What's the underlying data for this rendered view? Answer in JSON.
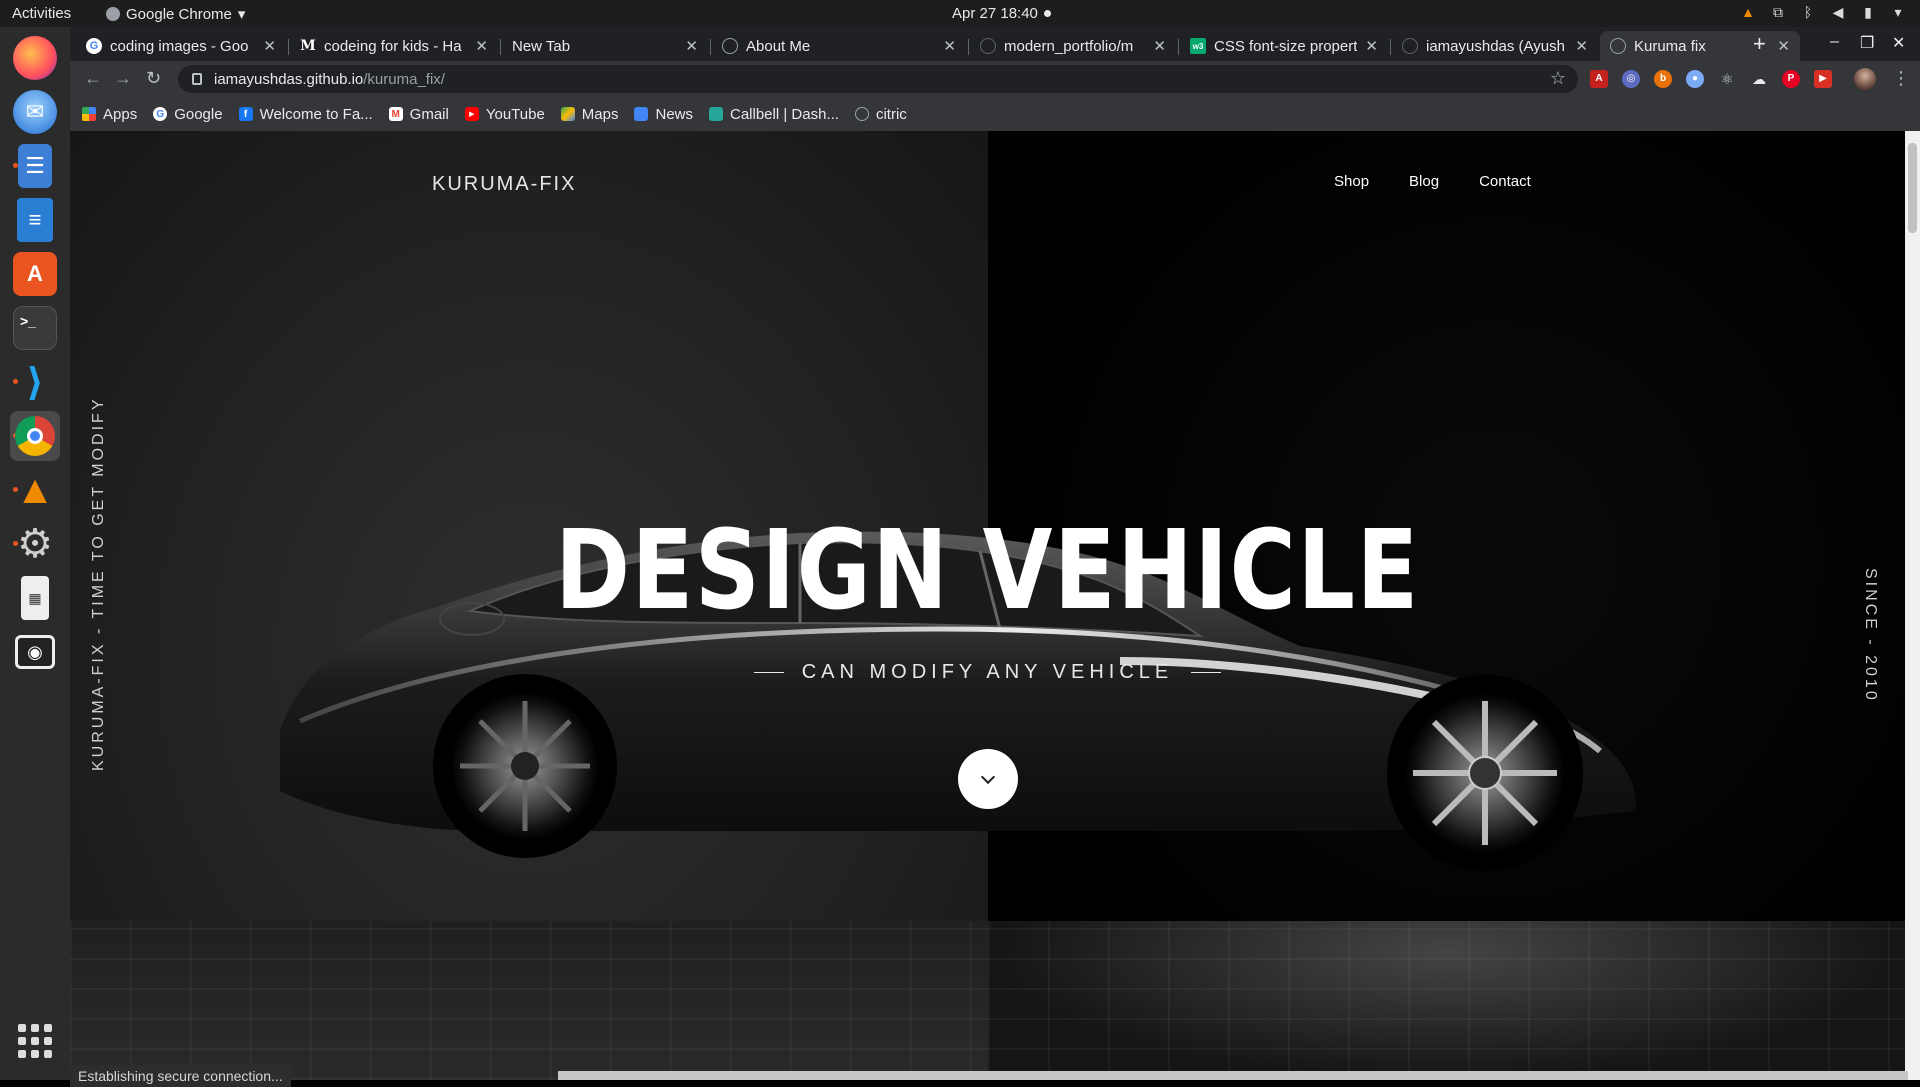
{
  "topbar": {
    "activities": "Activities",
    "app_menu": "Google Chrome",
    "clock": "Apr 27  18:40"
  },
  "dock": {
    "apps": [
      "firefox-icon",
      "thunderbird-icon",
      "files-icon",
      "writer-icon",
      "software-icon",
      "terminal-icon",
      "vscode-icon",
      "chrome-icon",
      "vlc-icon",
      "settings-icon",
      "calculator-icon",
      "screenshot-icon"
    ]
  },
  "tabs": [
    {
      "label": "coding images - Goo",
      "favicon": "google-icon"
    },
    {
      "label": "codeing for kids - Ha",
      "favicon": "medium-icon"
    },
    {
      "label": "New Tab",
      "favicon": ""
    },
    {
      "label": "About Me",
      "favicon": "globe-icon"
    },
    {
      "label": "modern_portfolio/m",
      "favicon": "github-icon"
    },
    {
      "label": "CSS font-size propert",
      "favicon": "w3-icon"
    },
    {
      "label": "iamayushdas (Ayush",
      "favicon": "github-icon"
    },
    {
      "label": "Kuruma fix",
      "favicon": "globe-icon"
    }
  ],
  "address": {
    "host": "iamayushdas.github.io",
    "path": "/kuruma_fix/"
  },
  "bookmarks": [
    {
      "label": "Apps",
      "icon": "apps-icon"
    },
    {
      "label": "Google",
      "icon": "google-icon"
    },
    {
      "label": "Welcome to Fa...",
      "icon": "facebook-icon"
    },
    {
      "label": "Gmail",
      "icon": "gmail-icon"
    },
    {
      "label": "YouTube",
      "icon": "youtube-icon"
    },
    {
      "label": "Maps",
      "icon": "maps-icon"
    },
    {
      "label": "News",
      "icon": "news-icon"
    },
    {
      "label": "Callbell | Dash...",
      "icon": "callbell-icon"
    },
    {
      "label": "citric",
      "icon": "globe-icon"
    }
  ],
  "page": {
    "brand": "KURUMA-FIX",
    "nav": [
      "Shop",
      "Blog",
      "Contact"
    ],
    "side_left": "KURUMA-FIX - TIME TO GET MODIFY",
    "side_right": "SINCE - 2010",
    "headline": "DESIGN VEHICLE",
    "subline": "CAN MODIFY ANY VEHICLE"
  },
  "status": "Establishing secure connection..."
}
